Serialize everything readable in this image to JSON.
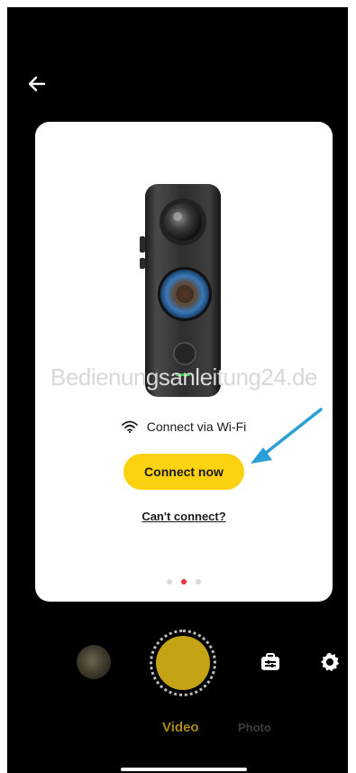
{
  "header": {
    "back_icon": "arrow-left-icon"
  },
  "card": {
    "watermark": "Bedienungsanleitung24.de",
    "wifi_icon": "wifi-icon",
    "wifi_label": "Connect via Wi-Fi",
    "connect_button": "Connect now",
    "cant_connect": "Can't connect?",
    "pager": {
      "count": 3,
      "active_index": 1
    }
  },
  "bottom": {
    "thumbnail_icon": "gallery-thumbnail",
    "shutter_icon": "shutter-button",
    "tools_icon": "toolbox-icon",
    "settings_icon": "gear-icon",
    "modes": [
      "Video",
      "Photo"
    ],
    "active_mode": "Video"
  },
  "colors": {
    "background": "#000000",
    "card": "#ffffff",
    "accent_yellow": "#fcd210",
    "pager_active": "#e8323c",
    "annotation_arrow": "#2a9fd6"
  }
}
